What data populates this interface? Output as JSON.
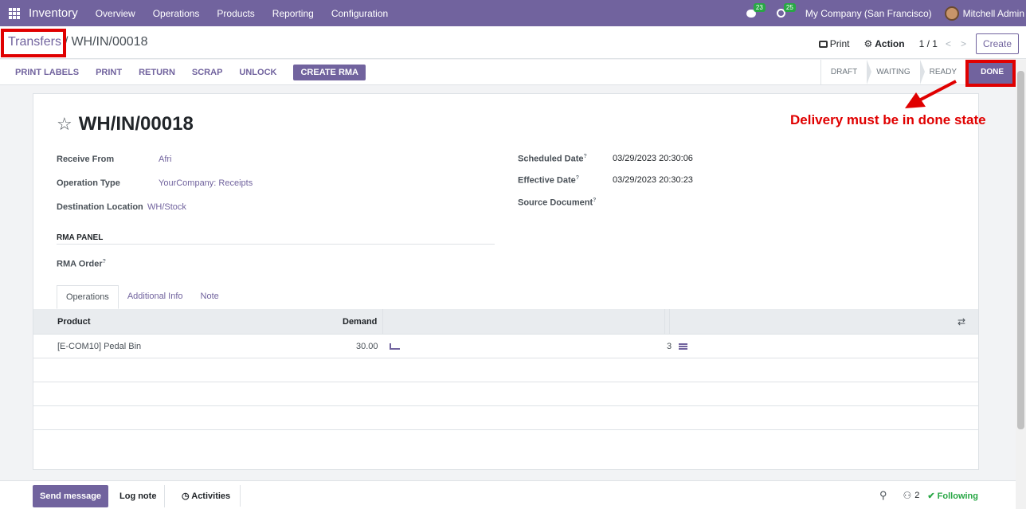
{
  "navbar": {
    "app_name": "Inventory",
    "menu": [
      "Overview",
      "Operations",
      "Products",
      "Reporting",
      "Configuration"
    ],
    "messages_count": "23",
    "activities_count": "25",
    "company": "My Company (San Francisco)",
    "user": "Mitchell Admin"
  },
  "breadcrumb": {
    "parent": "Transfers",
    "separator": "/",
    "current": "WH/IN/00018"
  },
  "control": {
    "print": "Print",
    "action": "Action",
    "pager": "1 / 1",
    "prev": "<",
    "next": ">",
    "create": "Create"
  },
  "actions": [
    "Print Labels",
    "Print",
    "Return",
    "Scrap",
    "Unlock"
  ],
  "primary_action": "Create RMA",
  "stages": [
    "Draft",
    "Waiting",
    "Ready",
    "Done"
  ],
  "record": {
    "title": "WH/IN/00018",
    "receive_from_label": "Receive From",
    "receive_from": "Afri",
    "operation_type_label": "Operation Type",
    "operation_type": "YourCompany: Receipts",
    "destination_label": "Destination Location",
    "destination": "WH/Stock",
    "scheduled_label": "Scheduled Date",
    "scheduled": "03/29/2023 20:30:06",
    "effective_label": "Effective Date",
    "effective": "03/29/2023 20:30:23",
    "source_label": "Source Document",
    "help_mark": "?",
    "rma_panel": "RMA Panel",
    "rma_order_label": "RMA Order"
  },
  "tabs": [
    "Operations",
    "Additional Info",
    "Note"
  ],
  "table": {
    "headers": {
      "product": "Product",
      "demand": "Demand"
    },
    "rows": [
      {
        "product": "[E-COM10] Pedal Bin",
        "demand": "30.00",
        "qty": "3"
      }
    ]
  },
  "annotation": "Delivery must be in done state",
  "chatter": {
    "send": "Send message",
    "log": "Log note",
    "activities": "Activities",
    "followers": "2",
    "following": "Following"
  },
  "colors": {
    "brand": "#71639e",
    "annotation": "#e00000",
    "success": "#28a745"
  }
}
